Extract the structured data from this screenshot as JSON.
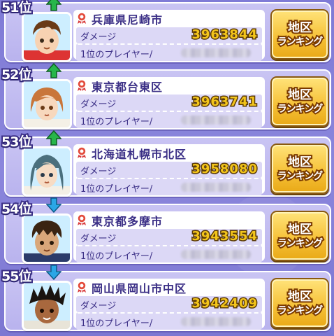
{
  "rows": [
    {
      "rank": "51位",
      "trend": "up",
      "city": "兵庫県尼崎市",
      "damage_label": "ダメージ",
      "damage": "3963844",
      "top_label": "1位のプレイヤー/",
      "button_line1": "地区",
      "button_line2": "ランキング",
      "avatar": "boy-brown-hair"
    },
    {
      "rank": "52位",
      "trend": "up",
      "city": "東京都台東区",
      "damage_label": "ダメージ",
      "damage": "3963741",
      "top_label": "1位のプレイヤー/",
      "button_line1": "地区",
      "button_line2": "ランキング",
      "avatar": "girl-orange-hair"
    },
    {
      "rank": "53位",
      "trend": "up",
      "city": "北海道札幌市北区",
      "damage_label": "ダメージ",
      "damage": "3958080",
      "top_label": "1位のプレイヤー/",
      "button_line1": "地区",
      "button_line2": "ランキング",
      "avatar": "girl-teal-hair"
    },
    {
      "rank": "54位",
      "trend": "down",
      "city": "東京都多摩市",
      "damage_label": "ダメージ",
      "damage": "3943554",
      "top_label": "1位のプレイヤー/",
      "button_line1": "地区",
      "button_line2": "ランキング",
      "avatar": "boy-dark-spiky"
    },
    {
      "rank": "55位",
      "trend": "down",
      "city": "岡山県岡山市中区",
      "damage_label": "ダメージ",
      "damage": "3942409",
      "top_label": "1位のプレイヤー/",
      "button_line1": "地区",
      "button_line2": "ランキング",
      "avatar": "boy-black-spiky-tan"
    }
  ],
  "colors": {
    "up": "#27b64a",
    "down": "#2aa6e6",
    "damage": "#f3c51b",
    "accent": "#3b2f86"
  }
}
